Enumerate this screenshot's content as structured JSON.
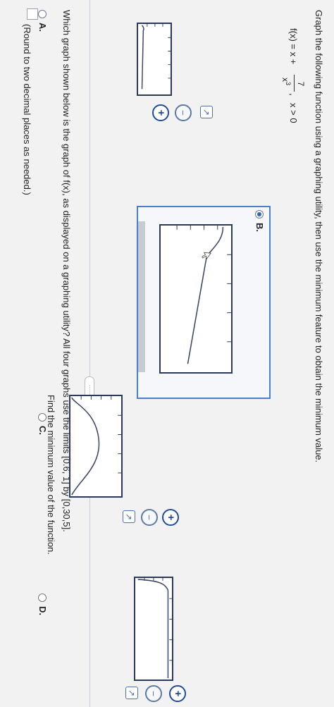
{
  "question": {
    "prompt": "Graph the following function using a graphing utility, then use the minimum feature to obtain the minimum value.",
    "function_lhs": "f(x) = x +",
    "numerator": "7",
    "denominator_base": "x",
    "denominator_exp": "3",
    "separator": ",",
    "condition": "x > 0"
  },
  "graph_question": "Which graph shown below is the graph of f(x), as displayed on a graphing utility? All four graphs use the limits [0.6, 1] by [0,30,5].",
  "divider_label": "·····",
  "options": [
    {
      "label": "A.",
      "selected": false
    },
    {
      "label": "B.",
      "selected": true
    },
    {
      "label": "C.",
      "selected": false
    },
    {
      "label": "D.",
      "selected": false
    }
  ],
  "minimum_question": "Find the minimum value of the function.",
  "answer_hint": "(Round to two decimal places as needed.)",
  "colors": {
    "accent": "#2b62c9",
    "graph_frame": "#2c3a5a",
    "curve": "#3a4666"
  },
  "icons": [
    "zoom-in-icon",
    "zoom-out-icon",
    "pop-out-icon"
  ]
}
